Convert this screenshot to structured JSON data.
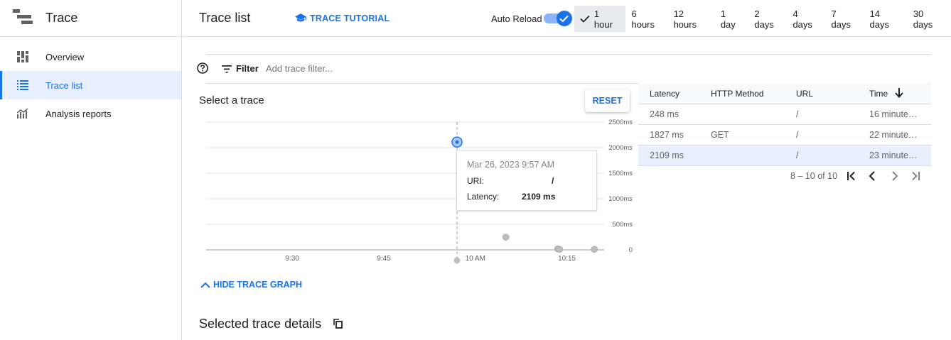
{
  "app": {
    "title": "Trace"
  },
  "sidebar": {
    "items": [
      {
        "label": "Overview",
        "icon": "dashboard-icon",
        "active": false
      },
      {
        "label": "Trace list",
        "icon": "list-icon",
        "active": true
      },
      {
        "label": "Analysis reports",
        "icon": "analytics-icon",
        "active": false
      }
    ]
  },
  "header": {
    "page_title": "Trace list",
    "tutorial_label": "TRACE TUTORIAL",
    "auto_reload_label": "Auto Reload",
    "auto_reload_on": true,
    "time_ranges": [
      "1 hour",
      "6 hours",
      "12 hours",
      "1 day",
      "2 days",
      "4 days",
      "7 days",
      "14 days",
      "30 days"
    ],
    "selected_range": "1 hour"
  },
  "filter": {
    "label": "Filter",
    "placeholder": "Add trace filter..."
  },
  "chart_panel": {
    "title": "Select a trace",
    "reset_label": "RESET",
    "hide_label": "HIDE TRACE GRAPH",
    "tooltip": {
      "date": "Mar 26, 2023 9:57 AM",
      "uri_label": "URI:",
      "uri_value": "/",
      "latency_label": "Latency:",
      "latency_value": "2109 ms"
    }
  },
  "chart_data": {
    "type": "scatter",
    "title": "",
    "xlabel": "",
    "ylabel": "",
    "y_ticks": [
      "2500ms",
      "2000ms",
      "1500ms",
      "1000ms",
      "500ms",
      "0"
    ],
    "y_tick_values": [
      2500,
      2000,
      1500,
      1000,
      500,
      0
    ],
    "x_ticks": [
      "9:30",
      "9:45",
      "10 AM",
      "10:15"
    ],
    "x_tick_minutes": [
      570,
      585,
      600,
      615
    ],
    "ylim": [
      0,
      2500
    ],
    "xlim_minutes": [
      555.9,
      621.1
    ],
    "selected_minute": 597,
    "grid": true,
    "points": [
      {
        "minute": 597,
        "latency_ms": 2109,
        "selected": true
      },
      {
        "minute": 598,
        "latency_ms": 1827,
        "selected": false
      },
      {
        "minute": 605,
        "latency_ms": 248,
        "selected": false
      },
      {
        "minute": 613.5,
        "latency_ms": 20,
        "selected": false
      },
      {
        "minute": 613.8,
        "latency_ms": 10,
        "selected": false
      },
      {
        "minute": 619.5,
        "latency_ms": 10,
        "selected": false
      }
    ]
  },
  "table": {
    "columns": [
      "Latency",
      "HTTP Method",
      "URL",
      "Time"
    ],
    "rows": [
      {
        "latency": "248 ms",
        "method": "",
        "url": "/",
        "time": "16 minute…",
        "highlighted": false
      },
      {
        "latency": "1827 ms",
        "method": "GET",
        "url": "/",
        "time": "22 minute…",
        "highlighted": false
      },
      {
        "latency": "2109 ms",
        "method": "",
        "url": "/",
        "time": "23 minute…",
        "highlighted": true
      }
    ],
    "pagination": "8 – 10 of 10"
  },
  "details": {
    "title": "Selected trace details"
  },
  "colors": {
    "accent": "#1a73e8",
    "selected_bg": "#e8f0fe",
    "border": "#dadce0",
    "point": "#bdbdbd"
  }
}
